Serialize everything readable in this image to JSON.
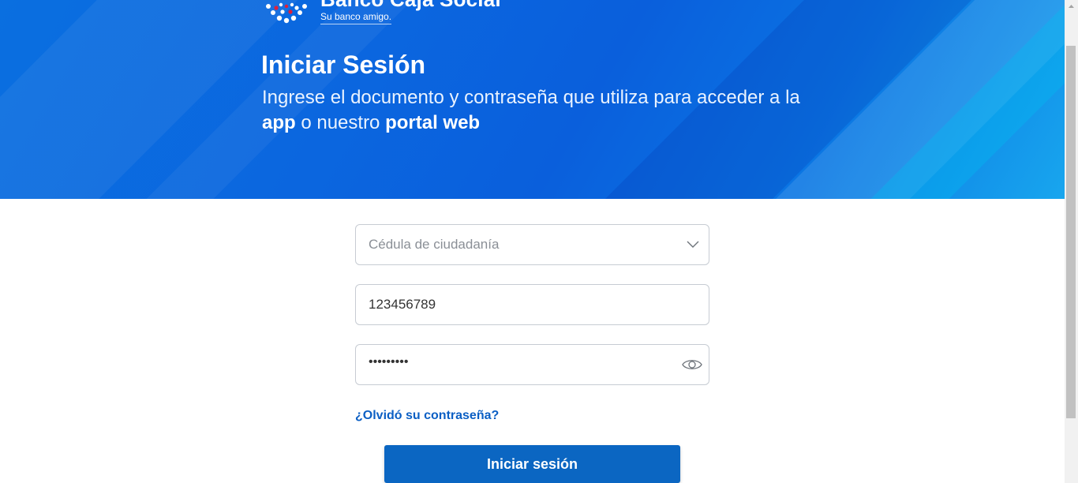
{
  "brand": {
    "name": "Banco Caja Social",
    "tagline": "Su banco amigo."
  },
  "hero": {
    "title": "Iniciar Sesión",
    "subtitle_part1": "Ingrese el documento y contraseña que utiliza para acceder a la ",
    "subtitle_app": "app",
    "subtitle_part2": " o nuestro ",
    "subtitle_portal": "portal web"
  },
  "form": {
    "document_type": {
      "selected": "Cédula de ciudadanía"
    },
    "document_number": {
      "value": "123456789"
    },
    "password": {
      "masked_value": "•••••••••"
    },
    "forgot_link": "¿Olvidó su contraseña?",
    "submit_label": "Iniciar sesión"
  },
  "colors": {
    "hero_blue": "#0a66df",
    "button_blue": "#0b66c2",
    "link_blue": "#0b5fc4"
  },
  "icons": [
    "bank-logo-icon",
    "chevron-down-icon",
    "eye-icon"
  ]
}
